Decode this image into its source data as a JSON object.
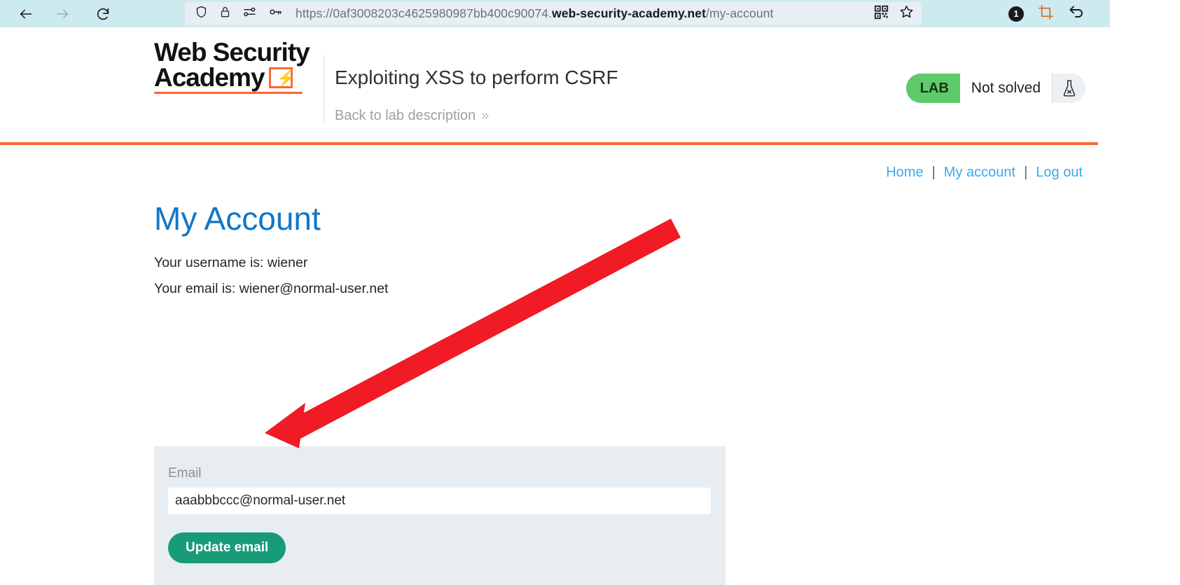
{
  "browser": {
    "back_icon": "back-arrow-icon",
    "forward_icon": "forward-arrow-icon",
    "reload_icon": "reload-icon",
    "url_prefix": "https://0af3008203c4625980987bb400c90074.",
    "url_domain": "web-security-academy.net",
    "url_path": "/my-account",
    "shield_icon": "shield-icon",
    "lock_icon": "lock-icon",
    "sliders_icon": "sliders-icon",
    "key_icon": "key-icon",
    "qr_icon": "qr-code-icon",
    "star_icon": "bookmark-star-icon",
    "notification_count": "1",
    "crop_icon": "crop-icon",
    "undo_icon": "undo-arrow-icon"
  },
  "site": {
    "logo_line1": "Web Security",
    "logo_line2": "Academy",
    "logo_flask_icon": "lightning-flask-icon",
    "lab_title": "Exploiting XSS to perform CSRF",
    "back_to_lab": "Back to lab description",
    "back_chevron": "»",
    "status": {
      "tag": "LAB",
      "state": "Not solved",
      "flask_icon": "flask-x-icon"
    },
    "accent_orange": "#ff6633",
    "accent_green": "#5ecb6a"
  },
  "nav": {
    "items": [
      {
        "label": "Home"
      },
      {
        "label": "My account"
      },
      {
        "label": "Log out"
      }
    ],
    "separator": "|"
  },
  "account": {
    "title": "My Account",
    "username_line": "Your username is: wiener",
    "email_line": "Your email is: wiener@normal-user.net"
  },
  "form": {
    "label": "Email",
    "value": "aaabbbccc@normal-user.net",
    "placeholder": "",
    "submit_label": "Update email",
    "button_color": "#189b78"
  },
  "annotation": {
    "arrow_color": "#f01b24",
    "type": "arrow-pointing-to-update-email-button"
  }
}
